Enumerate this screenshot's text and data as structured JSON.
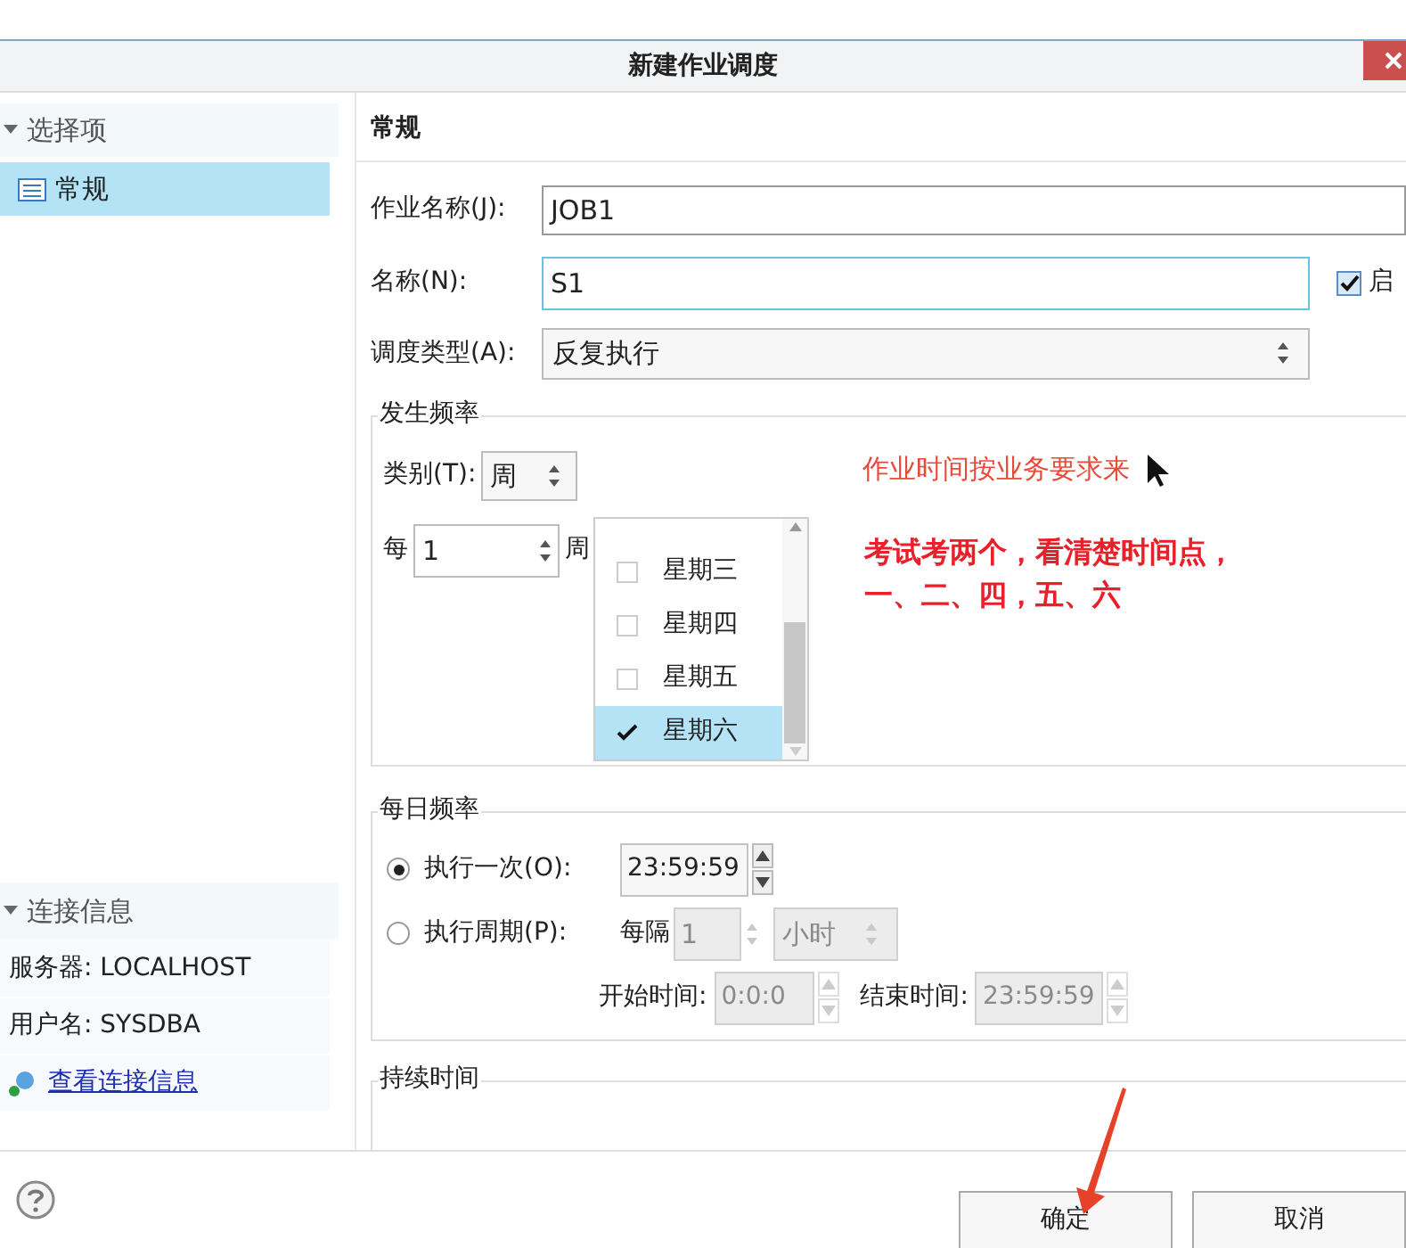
{
  "window": {
    "title": "新建作业调度"
  },
  "sidebar": {
    "sections": [
      {
        "title": "选择项",
        "expanded": true,
        "items": [
          {
            "label": "常规",
            "selected": true
          }
        ]
      },
      {
        "title": "连接信息",
        "expanded": true,
        "rows": [
          "服务器: LOCALHOST",
          "用户名: SYSDBA"
        ],
        "link": "查看连接信息"
      }
    ]
  },
  "form": {
    "heading": "常规",
    "job_name": {
      "label": "作业名称(J):",
      "value": "JOB1"
    },
    "name": {
      "label": "名称(N):",
      "value": "S1",
      "focused": true
    },
    "enable": {
      "label": "启",
      "checked": true
    },
    "schedule_type": {
      "label": "调度类型(A):",
      "value": "反复执行"
    },
    "frequency": {
      "title": "发生频率",
      "category_label": "类别(T):",
      "category": "周",
      "every_label": "每",
      "every": "1",
      "unit": "周",
      "days": [
        {
          "label": "星期三",
          "checked": false,
          "selected": false
        },
        {
          "label": "星期四",
          "checked": false,
          "selected": false
        },
        {
          "label": "星期五",
          "checked": false,
          "selected": false
        },
        {
          "label": "星期六",
          "checked": true,
          "selected": true
        }
      ]
    },
    "daily": {
      "title": "每日频率",
      "options": [
        {
          "label": "执行一次(O):",
          "selected": true
        },
        {
          "label": "执行周期(P):",
          "selected": false
        }
      ],
      "once_time": "23:59:59",
      "interval_label": "每隔",
      "interval": "1",
      "interval_unit": "小时",
      "start_label": "开始时间:",
      "start_time": "0:0:0",
      "end_label": "结束时间:",
      "end_time": "23:59:59",
      "period_disabled": true
    },
    "duration": {
      "title": "持续时间"
    }
  },
  "annotations": [
    {
      "text": "作业时间按业务要求来",
      "bold": false
    },
    {
      "text": "考试考两个，看清楚时间点，",
      "bold": true
    },
    {
      "text": "一、二、四，五、六",
      "bold": true
    }
  ],
  "buttons": [
    {
      "label": "确定"
    },
    {
      "label": "取消"
    }
  ]
}
